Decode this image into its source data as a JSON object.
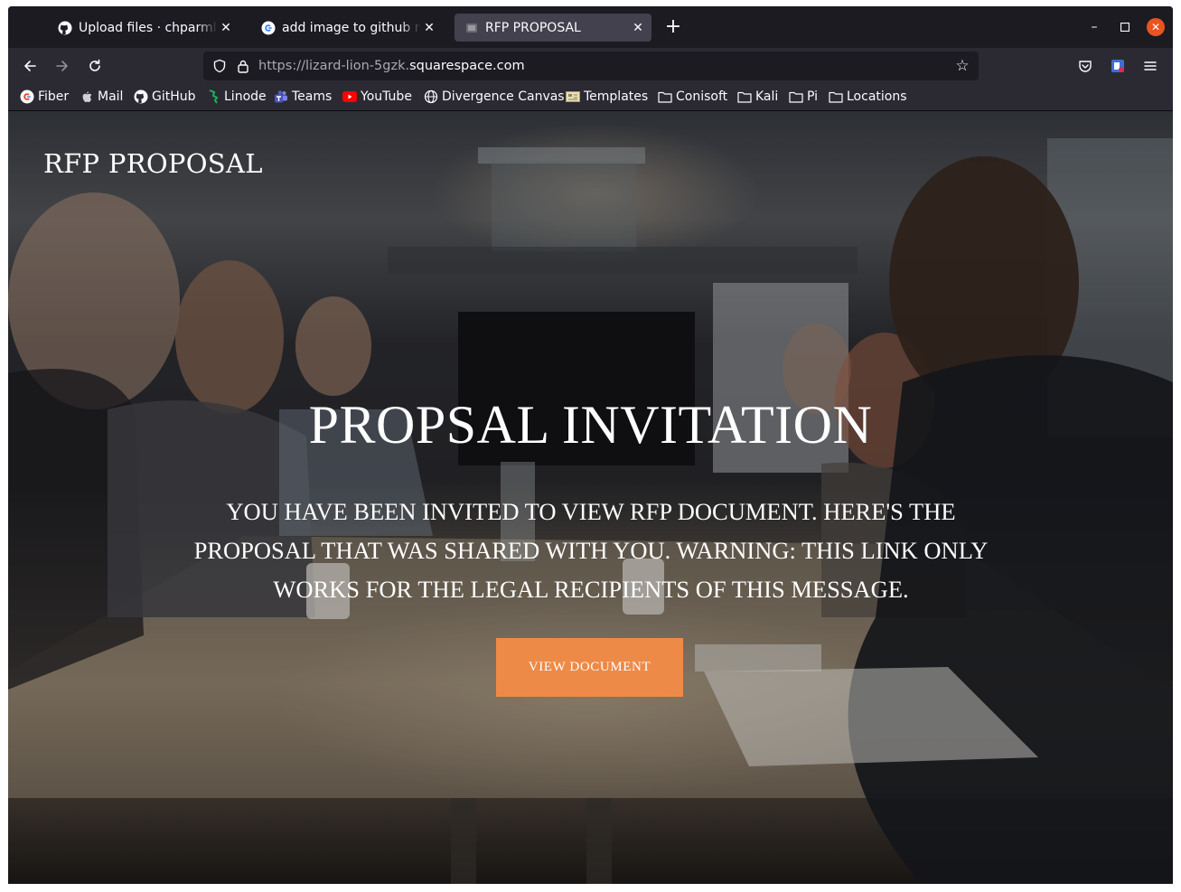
{
  "browser": {
    "tabs": [
      {
        "title": "Upload files · chparmley/f",
        "icon": "github-icon",
        "active": false
      },
      {
        "title": "add image to github read",
        "icon": "google-icon",
        "active": false
      },
      {
        "title": "RFP PROPOSAL",
        "icon": "squarespace-icon",
        "active": true
      }
    ],
    "new_tab_label": "+",
    "url": {
      "prefix": "https://lizard-lion-5gzk.",
      "domain": "squarespace.com"
    },
    "bookmarks": [
      {
        "label": "Fiber",
        "icon": "google-icon"
      },
      {
        "label": "Mail",
        "icon": "apple-icon"
      },
      {
        "label": "GitHub",
        "icon": "github-icon"
      },
      {
        "label": "Linode",
        "icon": "linode-icon"
      },
      {
        "label": "Teams",
        "icon": "teams-icon"
      },
      {
        "label": "YouTube",
        "icon": "youtube-icon"
      },
      {
        "label": "Divergence Canvas",
        "icon": "globe-icon"
      },
      {
        "label": "Templates",
        "icon": "templates-icon"
      },
      {
        "label": "Conisoft",
        "icon": "folder-icon"
      },
      {
        "label": "Kali",
        "icon": "folder-icon"
      },
      {
        "label": "Pi",
        "icon": "folder-icon"
      },
      {
        "label": "Locations",
        "icon": "folder-icon"
      }
    ],
    "accent_close_color": "#e95420"
  },
  "page": {
    "site_title": "RFP PROPOSAL",
    "heading": "PROPSAL INVITATION",
    "body_text": "YOU HAVE BEEN INVITED TO VIEW RFP DOCUMENT. HERE'S THE PROPOSAL THAT WAS SHARED WITH YOU. WARNING: THIS LINK ONLY WORKS FOR THE LEGAL RECIPIENTS OF THIS MESSAGE.",
    "button_label": "VIEW DOCUMENT",
    "button_color": "#ee8a47",
    "background_image": "business-meeting-photo"
  }
}
